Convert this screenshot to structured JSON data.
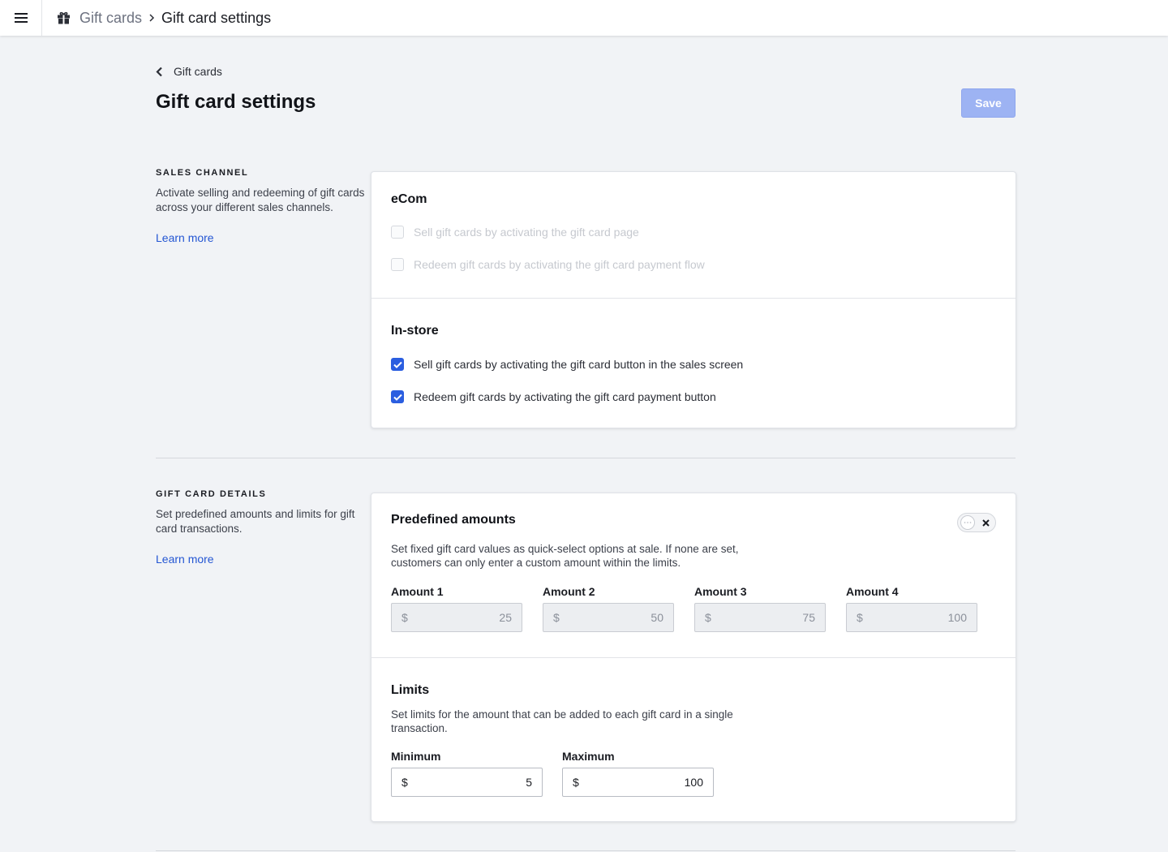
{
  "topbar": {
    "menu_icon": "hamburger-menu-icon",
    "section_icon": "gift-icon",
    "breadcrumb_parent": "Gift cards",
    "breadcrumb_separator_icon": "chevron-right-icon",
    "breadcrumb_current": "Gift card settings"
  },
  "header": {
    "back_label": "Gift cards",
    "back_icon": "chevron-left-icon",
    "title": "Gift card settings",
    "save_label": "Save"
  },
  "sales_channel": {
    "heading": "SALES CHANNEL",
    "description": "Activate selling and redeeming of gift cards across your different sales channels.",
    "learn_more": "Learn more",
    "ecom": {
      "title": "eCom",
      "options": [
        {
          "label": "Sell gift cards by activating the gift card page",
          "checked": false,
          "disabled": true
        },
        {
          "label": "Redeem gift cards by activating the gift card payment flow",
          "checked": false,
          "disabled": true
        }
      ]
    },
    "instore": {
      "title": "In-store",
      "options": [
        {
          "label": "Sell gift cards by activating the gift card button in the sales screen",
          "checked": true,
          "disabled": false
        },
        {
          "label": "Redeem gift cards by activating the gift card payment button",
          "checked": true,
          "disabled": false
        }
      ]
    }
  },
  "gift_card_details": {
    "heading": "GIFT CARD DETAILS",
    "description": "Set predefined amounts and limits for gift card transactions.",
    "learn_more": "Learn more",
    "predefined": {
      "title": "Predefined amounts",
      "toggle_on": false,
      "description": "Set fixed gift card values as quick-select options at sale. If none are set, customers can only enter a custom amount within the limits.",
      "amounts": [
        {
          "label": "Amount 1",
          "currency": "$",
          "value": "25"
        },
        {
          "label": "Amount 2",
          "currency": "$",
          "value": "50"
        },
        {
          "label": "Amount 3",
          "currency": "$",
          "value": "75"
        },
        {
          "label": "Amount 4",
          "currency": "$",
          "value": "100"
        }
      ]
    },
    "limits": {
      "title": "Limits",
      "description": "Set limits for the amount that can be added to each gift card in a single transaction.",
      "minimum": {
        "label": "Minimum",
        "currency": "$",
        "value": "5"
      },
      "maximum": {
        "label": "Maximum",
        "currency": "$",
        "value": "100"
      }
    }
  },
  "colors": {
    "accent": "#2b5ee0",
    "save_disabled": "#9db3f3",
    "link": "#2456d3",
    "page_bg": "#f1f3f6"
  }
}
